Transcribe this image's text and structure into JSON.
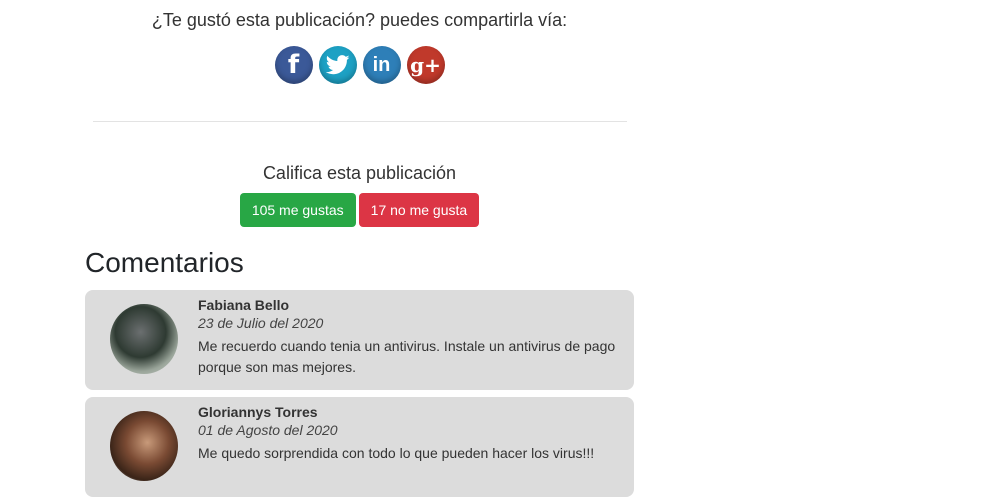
{
  "share": {
    "prompt": "¿Te gustó esta publicación? puedes compartirla vía:",
    "networks": [
      {
        "name": "facebook",
        "icon": "facebook-icon",
        "glyph": "f",
        "color": "#3b5998"
      },
      {
        "name": "twitter",
        "icon": "twitter-icon",
        "glyph": "",
        "color": "#1da1c4"
      },
      {
        "name": "linkedin",
        "icon": "linkedin-icon",
        "glyph": "in",
        "color": "#2e7fb8"
      },
      {
        "name": "googleplus",
        "icon": "google-plus-icon",
        "glyph": "g+",
        "color": "#c0392b"
      }
    ]
  },
  "rating": {
    "title": "Califica esta publicación",
    "like_label": "105 me gustas",
    "dislike_label": "17 no me gusta",
    "like_color": "#28a745",
    "dislike_color": "#dc3545"
  },
  "comments": {
    "heading": "Comentarios",
    "items": [
      {
        "author": "Fabiana Bello",
        "date": "23 de Julio del 2020",
        "text": "Me recuerdo cuando tenia un antivirus. Instale un antivirus de pago porque son mas mejores."
      },
      {
        "author": "Gloriannys Torres",
        "date": "01 de Agosto del 2020",
        "text": "Me quedo sorprendida con todo lo que pueden hacer los virus!!!"
      }
    ]
  }
}
